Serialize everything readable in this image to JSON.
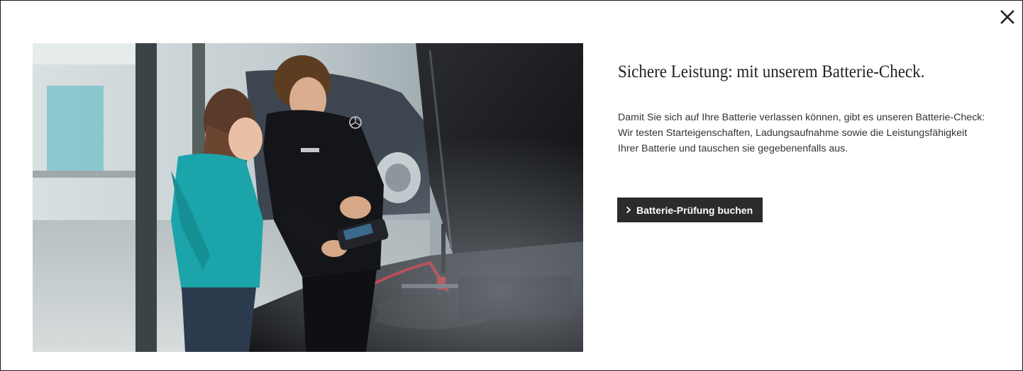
{
  "dialog": {
    "close_icon": "close-icon",
    "hero_image_alt": "Mechanic and customer checking car battery",
    "title": "Sichere Leistung: mit unserem Batterie-Check.",
    "description_lines": [
      "Damit Sie sich auf Ihre Batterie verlassen können, gibt es unseren Batterie-Check:",
      "Wir testen Starteigenschaften, Ladungsaufnahme sowie die Leistungsfähigkeit",
      "Ihrer Batterie und tauschen sie gegebenenfalls aus."
    ],
    "cta_label": "Batterie-Prüfung buchen",
    "cta_icon": "chevron-right-icon"
  },
  "colors": {
    "button_bg": "#2b2b2b",
    "button_text": "#ffffff",
    "title_text": "#222222",
    "body_text": "#333333",
    "accent_teal": "#1aa3a8"
  }
}
